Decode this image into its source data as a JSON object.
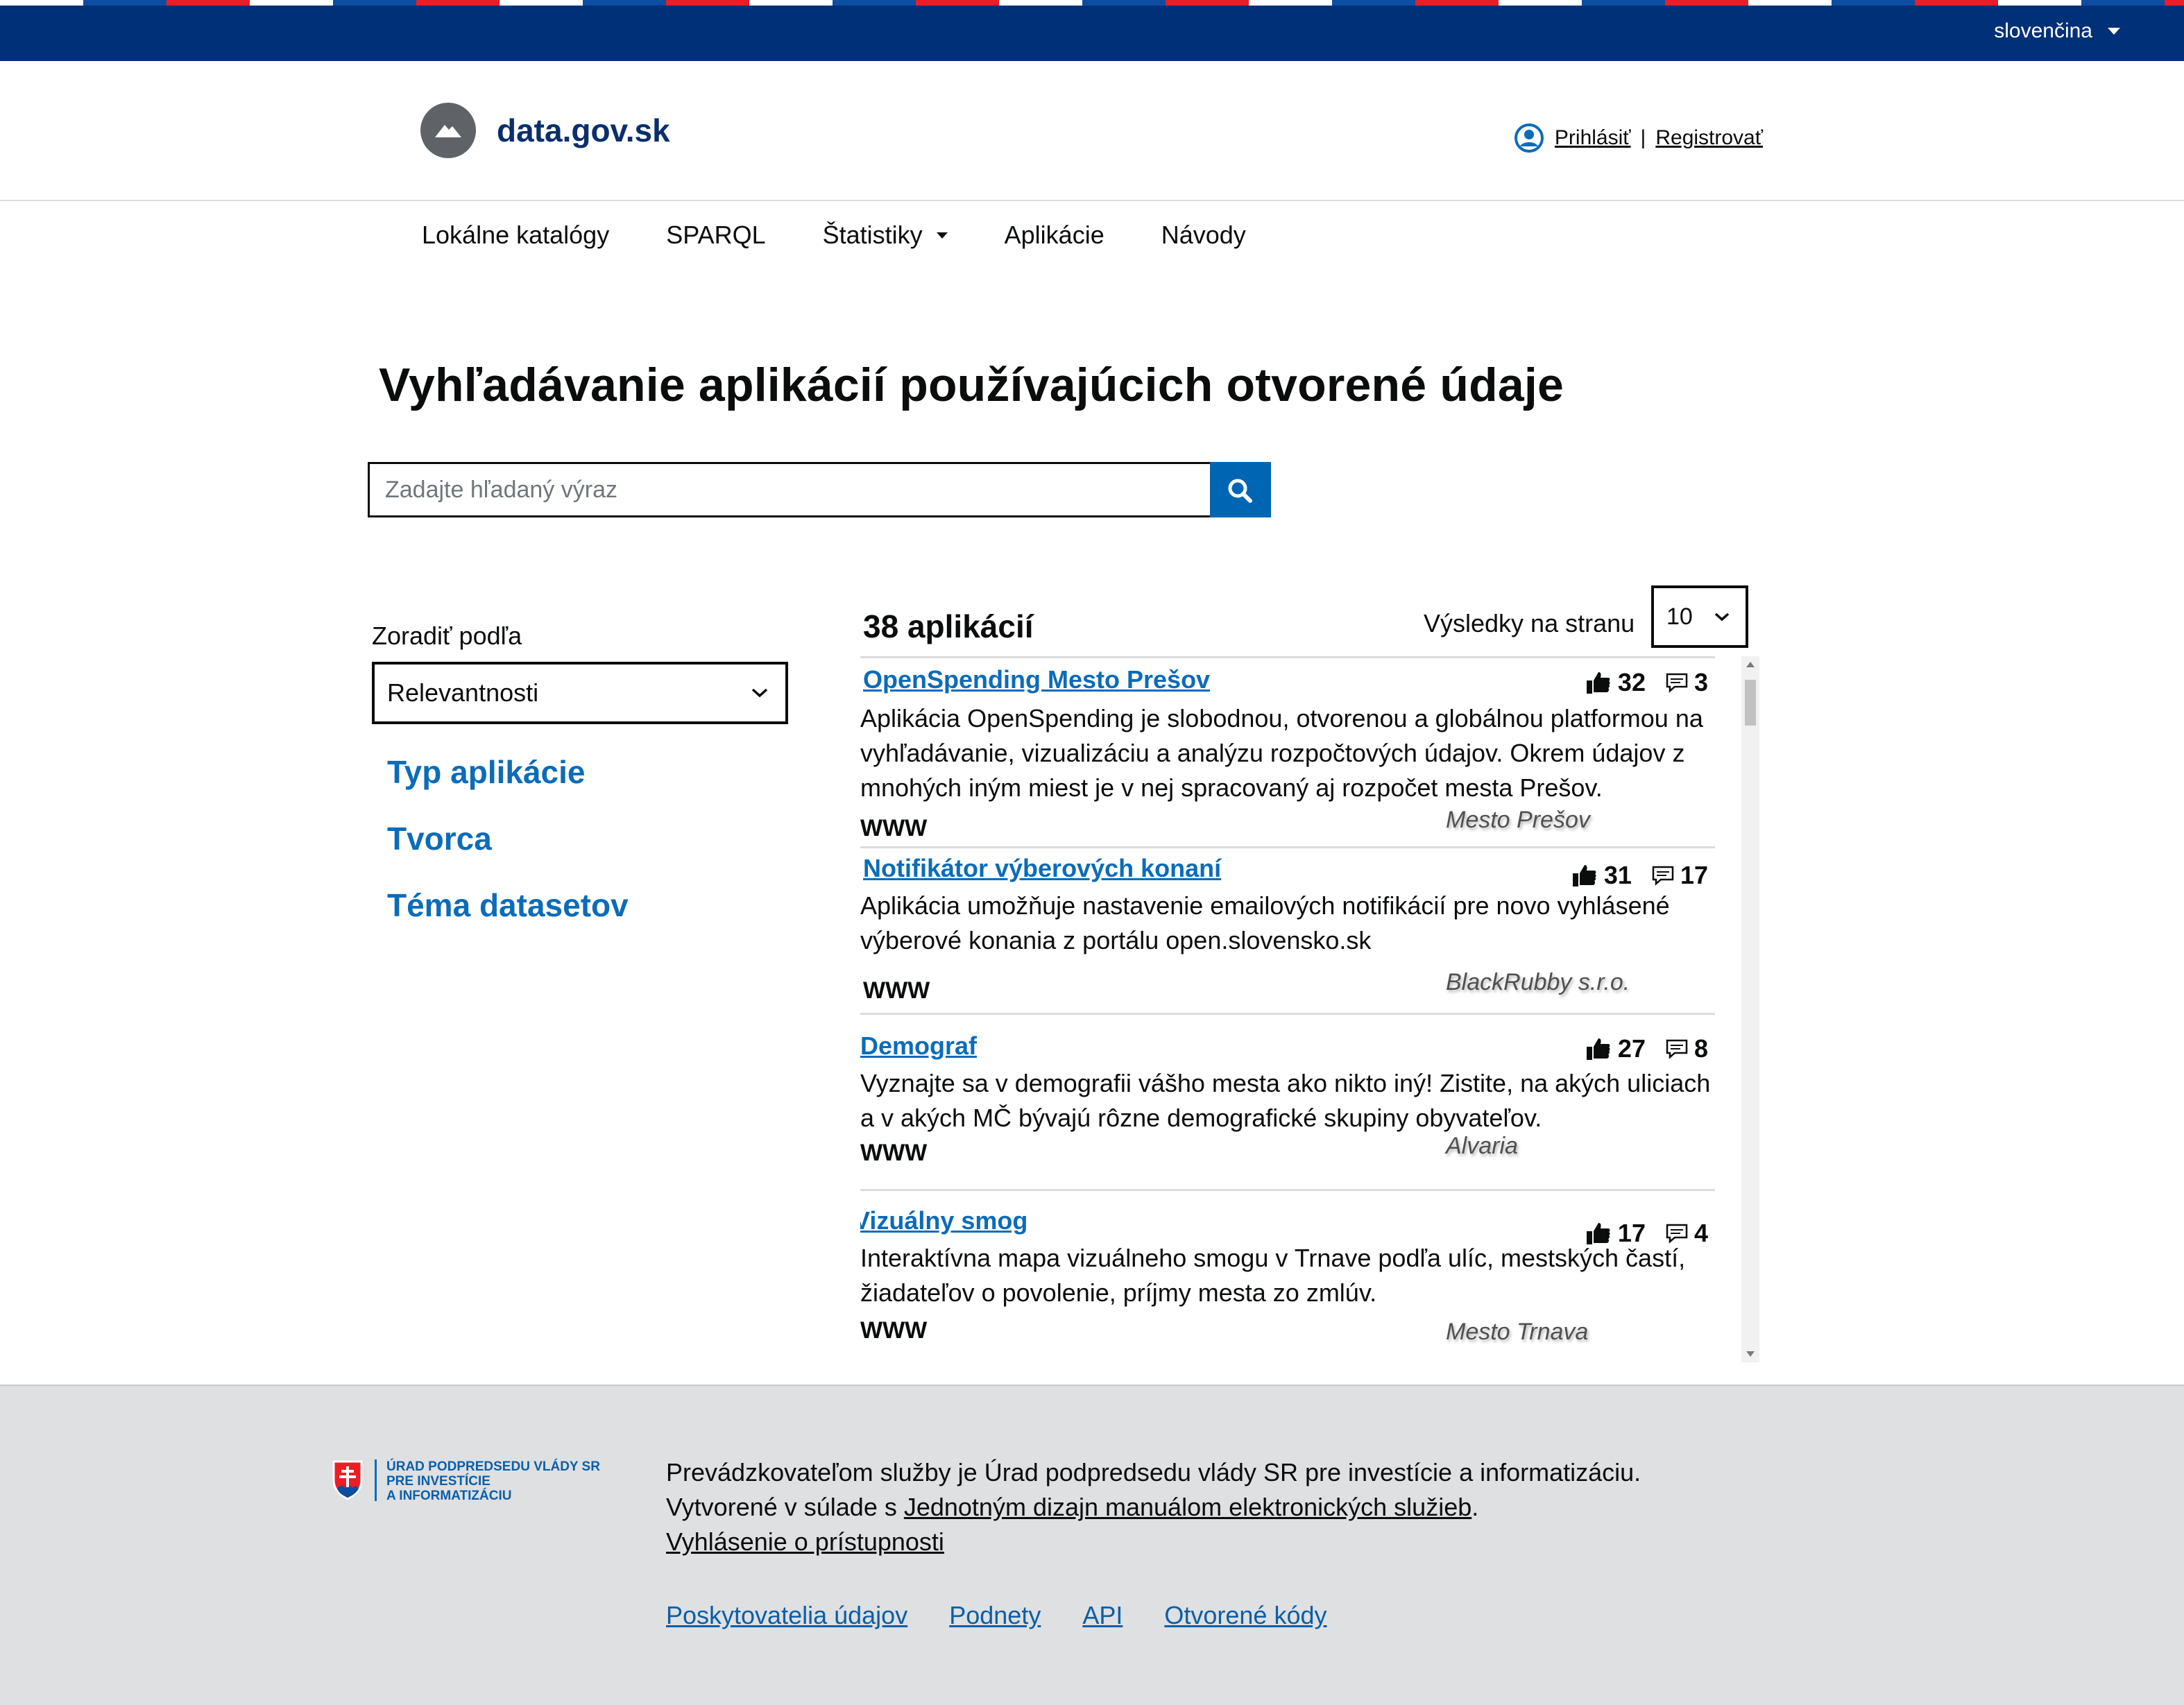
{
  "topbar": {
    "language": "slovenčina"
  },
  "header": {
    "logo_text": "data.gov.sk",
    "login": "Prihlásiť",
    "separator": "|",
    "register": "Registrovať"
  },
  "nav": {
    "items": [
      "Lokálne katalógy",
      "SPARQL",
      "Štatistiky",
      "Aplikácie",
      "Návody"
    ]
  },
  "page_title": "Vyhľadávanie aplikácií používajúcich otvorené údaje",
  "search": {
    "placeholder": "Zadajte hľadaný výraz",
    "value": ""
  },
  "sidebar": {
    "sort_label": "Zoradiť podľa",
    "sort_value": "Relevantnosti",
    "filters": [
      "Typ aplikácie",
      "Tvorca",
      "Téma datasetov"
    ]
  },
  "results": {
    "count": "38 aplikácií",
    "per_page_label": "Výsledky na stranu",
    "per_page_value": "10",
    "items": [
      {
        "title": "OpenSpending Mesto Prešov",
        "likes": "32",
        "comments": "3",
        "description": "Aplikácia OpenSpending je slobodnou, otvorenou a globálnou platformou na vyhľadávanie, vizualizáciu a analýzu rozpočtových údajov. Okrem údajov z mnohých iným miest je v nej spracovaný aj rozpočet mesta Prešov.",
        "type": "WWW",
        "author": "Mesto Prešov"
      },
      {
        "title": "Notifikátor výberových konaní",
        "likes": "31",
        "comments": "17",
        "description": "Aplikácia umožňuje nastavenie emailových notifikácií pre novo vyhlásené výberové konania z portálu open.slovensko.sk",
        "type": "WWW",
        "author": "BlackRubby s.r.o."
      },
      {
        "title": "Demograf",
        "likes": "27",
        "comments": "8",
        "description": "Vyznajte sa v demografii vášho mesta ako nikto iný! Zistite, na akých uliciach a v akých MČ bývajú rôzne demografické skupiny obyvateľov.",
        "type": "WWW",
        "author": "Alvaria"
      },
      {
        "title": "Vizuálny smog",
        "likes": "17",
        "comments": "4",
        "description": "Interaktívna mapa vizuálneho smogu v Trnave podľa ulíc, mestských častí, žiadateľov o povolenie, príjmy mesta zo zmlúv.",
        "type": "WWW",
        "author": "Mesto Trnava"
      }
    ]
  },
  "footer": {
    "gov_logo_lines": [
      "ÚRAD PODPREDSEDU VLÁDY SR",
      "PRE INVESTÍCIE",
      "A INFORMATIZÁCIU"
    ],
    "operator_text": "Prevádzkovateľom služby je Úrad podpredsedu vlády SR pre investície a informatizáciu.",
    "created_prefix": "Vytvorené v súlade s ",
    "manual_link": "Jednotným dizajn manuálom elektronických služieb",
    "created_suffix": ".",
    "accessibility_link": "Vyhlásenie o prístupnosti",
    "links": [
      "Poskytovatelia údajov",
      "Podnety",
      "API",
      "Otvorené kódy"
    ]
  },
  "colors": {
    "topbar": "#003078",
    "stripe_blue": "#0b4ea2",
    "stripe_red": "#ee1c25",
    "link_blue": "#0b6cb9",
    "search_button": "#0065b3",
    "footer_bg": "#dee0e2"
  },
  "icons": [
    "caret-down-icon",
    "mountain-logo-icon",
    "user-circle-icon",
    "search-icon",
    "chevron-down-icon",
    "thumbs-up-icon",
    "comment-icon",
    "slovak-coat-of-arms-icon"
  ]
}
